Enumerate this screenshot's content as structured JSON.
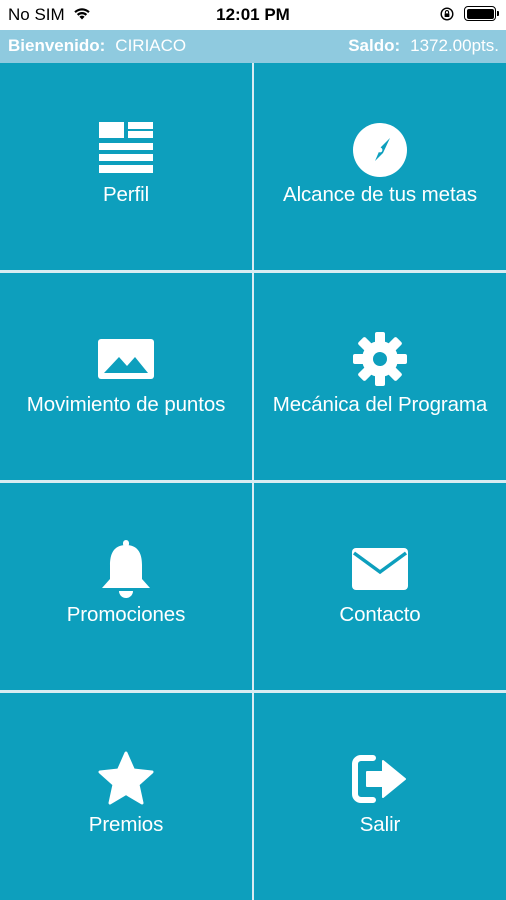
{
  "status": {
    "carrier": "No SIM",
    "time": "12:01 PM"
  },
  "header": {
    "welcome_label": "Bienvenido:",
    "user_name": "CIRIACO",
    "balance_label": "Saldo:",
    "balance_value": "1372.00pts."
  },
  "menu": [
    {
      "label": "Perfil",
      "icon": "profile-card-icon"
    },
    {
      "label": "Alcance de tus metas",
      "icon": "compass-icon"
    },
    {
      "label": "Movimiento de puntos",
      "icon": "image-icon"
    },
    {
      "label": "Mecánica del Programa",
      "icon": "gear-icon"
    },
    {
      "label": "Promociones",
      "icon": "bell-icon"
    },
    {
      "label": "Contacto",
      "icon": "envelope-icon"
    },
    {
      "label": "Premios",
      "icon": "star-icon"
    },
    {
      "label": "Salir",
      "icon": "logout-icon"
    }
  ],
  "colors": {
    "tile": "#0d9fbd",
    "header_bar": "#8fcadf",
    "divider": "#d8ecf2"
  }
}
